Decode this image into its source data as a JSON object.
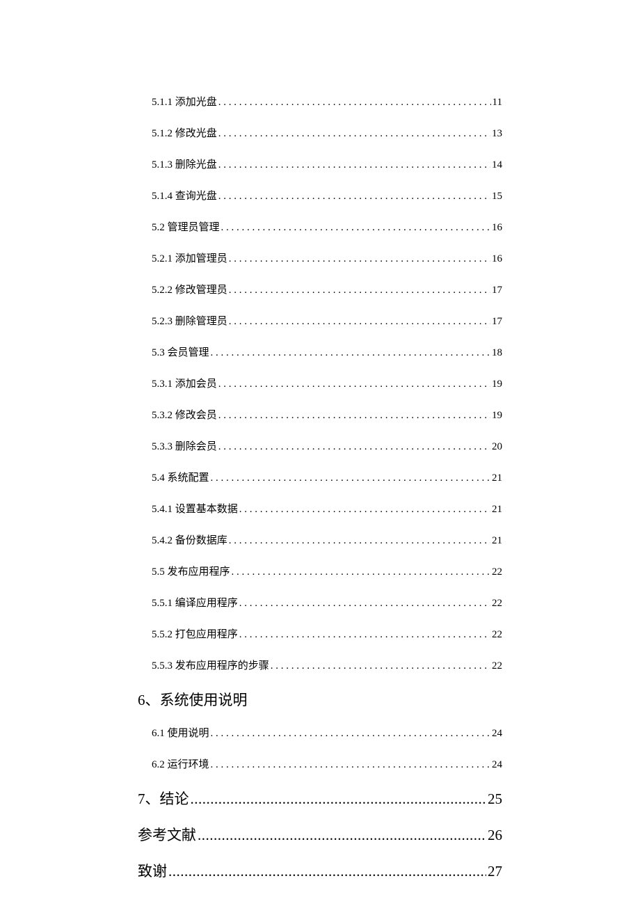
{
  "toc": [
    {
      "label": "5.1.1 添加光盘",
      "page": "11",
      "level": "sub",
      "leader": "dots"
    },
    {
      "label": "5.1.2 修改光盘",
      "page": "13",
      "level": "sub",
      "leader": "dots"
    },
    {
      "label": "5.1.3 删除光盘",
      "page": "14",
      "level": "sub",
      "leader": "dots"
    },
    {
      "label": "5.1.4 查询光盘",
      "page": "15",
      "level": "sub",
      "leader": "dots"
    },
    {
      "label": "5.2 管理员管理",
      "page": "16",
      "level": "sub",
      "leader": "dots"
    },
    {
      "label": "5.2.1 添加管理员",
      "page": "16",
      "level": "sub",
      "leader": "dots"
    },
    {
      "label": "5.2.2 修改管理员",
      "page": "17",
      "level": "sub",
      "leader": "dots"
    },
    {
      "label": "5.2.3 删除管理员",
      "page": "17",
      "level": "sub",
      "leader": "dots"
    },
    {
      "label": "5.3 会员管理",
      "page": "18",
      "level": "sub",
      "leader": "dots"
    },
    {
      "label": "5.3.1 添加会员",
      "page": "19",
      "level": "sub",
      "leader": "dots"
    },
    {
      "label": "5.3.2 修改会员",
      "page": "19",
      "level": "sub",
      "leader": "dots"
    },
    {
      "label": "5.3.3 删除会员",
      "page": "20",
      "level": "sub",
      "leader": "dots"
    },
    {
      "label": "5.4 系统配置",
      "page": "21",
      "level": "sub",
      "leader": "dots"
    },
    {
      "label": "5.4.1 设置基本数据",
      "page": "21",
      "level": "sub",
      "leader": "dots"
    },
    {
      "label": "5.4.2 备份数据库",
      "page": "21",
      "level": "sub",
      "leader": "dots"
    },
    {
      "label": "5.5 发布应用程序",
      "page": "22",
      "level": "sub",
      "leader": "dots"
    },
    {
      "label": "5.5.1 编译应用程序",
      "page": "22",
      "level": "sub",
      "leader": "dots"
    },
    {
      "label": "5.5.2 打包应用程序",
      "page": "22",
      "level": "sub",
      "leader": "dots"
    },
    {
      "label": "5.5.3 发布应用程序的步骤",
      "page": "22",
      "level": "sub",
      "leader": "dots"
    },
    {
      "label": "6、系统使用说明",
      "page": "",
      "level": "h1",
      "leader": "none"
    },
    {
      "label": "6.1 使用说明",
      "page": "24",
      "level": "sub",
      "leader": "dots"
    },
    {
      "label": "6.2 运行环境",
      "page": "24",
      "level": "sub",
      "leader": "dots"
    },
    {
      "label": "7、结论",
      "page": "25",
      "level": "h1",
      "leader": "tight"
    },
    {
      "label": "参考文献",
      "page": "26",
      "level": "h1",
      "leader": "tight"
    },
    {
      "label": "致谢",
      "page": "27",
      "level": "h1",
      "leader": "tight"
    }
  ]
}
